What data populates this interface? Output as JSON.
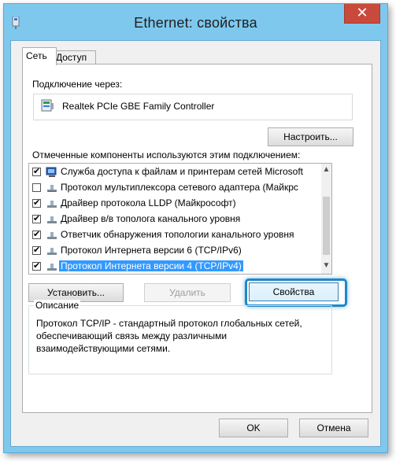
{
  "window": {
    "title": "Ethernet: свойства",
    "close_label": "✕"
  },
  "tabs": [
    {
      "label": "Сеть",
      "active": true
    },
    {
      "label": "Доступ",
      "active": false
    }
  ],
  "connection": {
    "label": "Подключение через:",
    "device_name": "Realtek PCIe GBE Family Controller",
    "configure_button": "Настроить..."
  },
  "components": {
    "label": "Отмеченные компоненты используются этим подключением:",
    "items": [
      {
        "label": "Служба доступа к файлам и принтерам сетей Microsoft",
        "checked": true,
        "icon": "service-icon"
      },
      {
        "label": "Протокол мультиплексора сетевого адаптера (Майкрс",
        "checked": false,
        "icon": "protocol-icon"
      },
      {
        "label": "Драйвер протокола LLDP (Майкрософт)",
        "checked": true,
        "icon": "protocol-icon"
      },
      {
        "label": "Драйвер в/в тополога канального уровня",
        "checked": true,
        "icon": "protocol-icon"
      },
      {
        "label": "Ответчик обнаружения топологии канального уровня",
        "checked": true,
        "icon": "protocol-icon"
      },
      {
        "label": "Протокол Интернета версии 6 (TCP/IPv6)",
        "checked": true,
        "icon": "protocol-icon"
      },
      {
        "label": "Протокол Интернета версии 4 (TCP/IPv4)",
        "checked": true,
        "icon": "protocol-icon",
        "selected": true
      }
    ]
  },
  "buttons": {
    "install": "Установить...",
    "remove": "Удалить",
    "properties": "Свойства"
  },
  "description": {
    "title": "Описание",
    "text": "Протокол TCP/IP - стандартный протокол глобальных сетей, обеспечивающий связь между различными взаимодействующими сетями."
  },
  "footer": {
    "ok": "OK",
    "cancel": "Отмена"
  },
  "colors": {
    "frame": "#7ec8ee",
    "close": "#c94a3b",
    "selection": "#3399ff",
    "focus_ring": "#1e88c8"
  }
}
